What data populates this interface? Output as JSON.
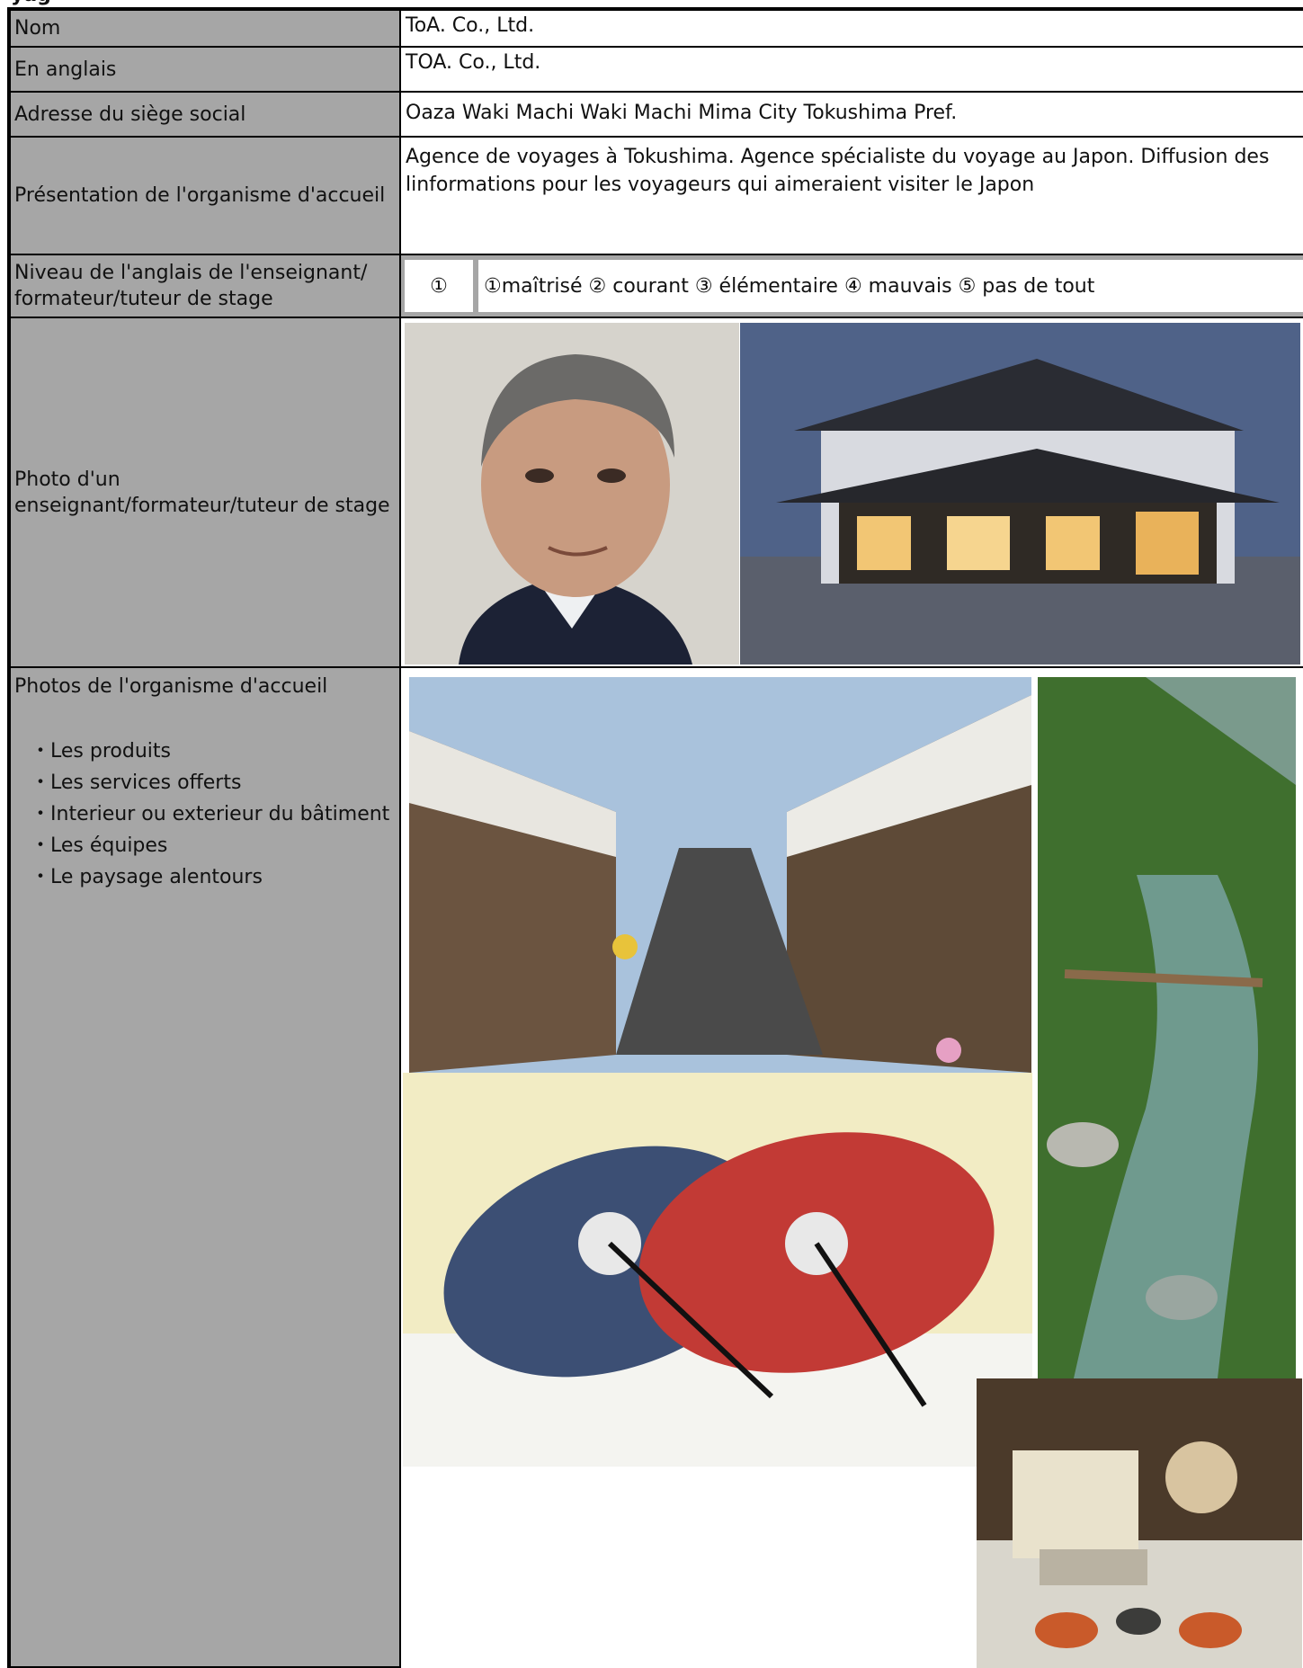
{
  "header_fragment": "yag",
  "rows": {
    "nom": {
      "label": "Nom",
      "value": "ToA. Co., Ltd."
    },
    "anglais": {
      "label": "En anglais",
      "value": "TOA. Co., Ltd."
    },
    "adresse": {
      "label": "Adresse du siège social",
      "value": "Oaza Waki Machi Waki Machi Mima City Tokushima Pref."
    },
    "presentation": {
      "label": "Présentation de l'organisme d'accueil",
      "value": "Agence de voyages à Tokushima. Agence spécialiste du voyage au Japon. Diffusion des linformations pour les voyageurs qui aimeraient visiter le Japon"
    },
    "niveau": {
      "label": "Niveau de l'anglais de l'enseignant/ formateur/tuteur de stage",
      "selected": "①",
      "options": "①maîtrisé  ② courant  ③ élémentaire  ④ mauvais ⑤ pas de tout"
    },
    "photo_tuteur": {
      "label": "Photo d'un enseignant/formateur/tuteur de stage"
    },
    "photos_organisme": {
      "label": "Photos de l'organisme d'accueil",
      "items": [
        "Les produits",
        "Les services offerts",
        "Interieur ou exterieur du bâtiment",
        "Les équipes",
        "Le paysage alentours"
      ]
    }
  },
  "colors": {
    "label_bg": "#a6a6a6",
    "border": "#000000",
    "value_bg": "#ffffff"
  }
}
